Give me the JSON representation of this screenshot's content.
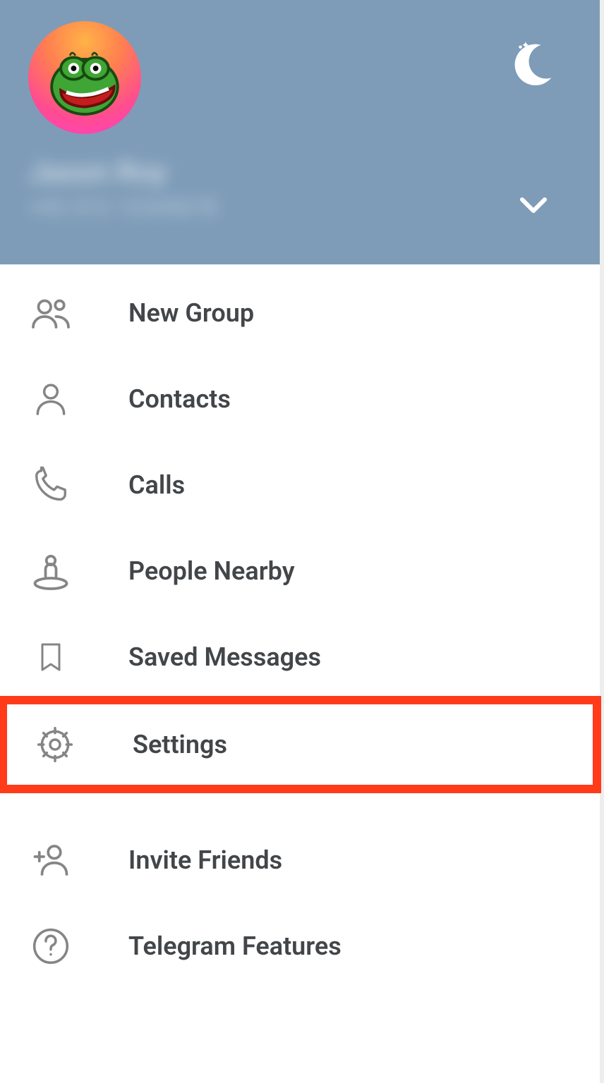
{
  "header": {
    "user_name": "Jason Roy",
    "user_phone": "+92 312 12345678"
  },
  "menu": {
    "items": [
      {
        "icon": "group-icon",
        "label": "New Group"
      },
      {
        "icon": "person-icon",
        "label": "Contacts"
      },
      {
        "icon": "phone-icon",
        "label": "Calls"
      },
      {
        "icon": "nearby-icon",
        "label": "People Nearby"
      },
      {
        "icon": "bookmark-icon",
        "label": "Saved Messages"
      },
      {
        "icon": "gear-icon",
        "label": "Settings"
      },
      {
        "icon": "invite-icon",
        "label": "Invite Friends"
      },
      {
        "icon": "help-icon",
        "label": "Telegram Features"
      }
    ],
    "highlighted_index": 5
  },
  "colors": {
    "header_bg": "#7e9cb8",
    "icon": "#858585",
    "text": "#434649",
    "highlight": "#ff3b1a"
  }
}
